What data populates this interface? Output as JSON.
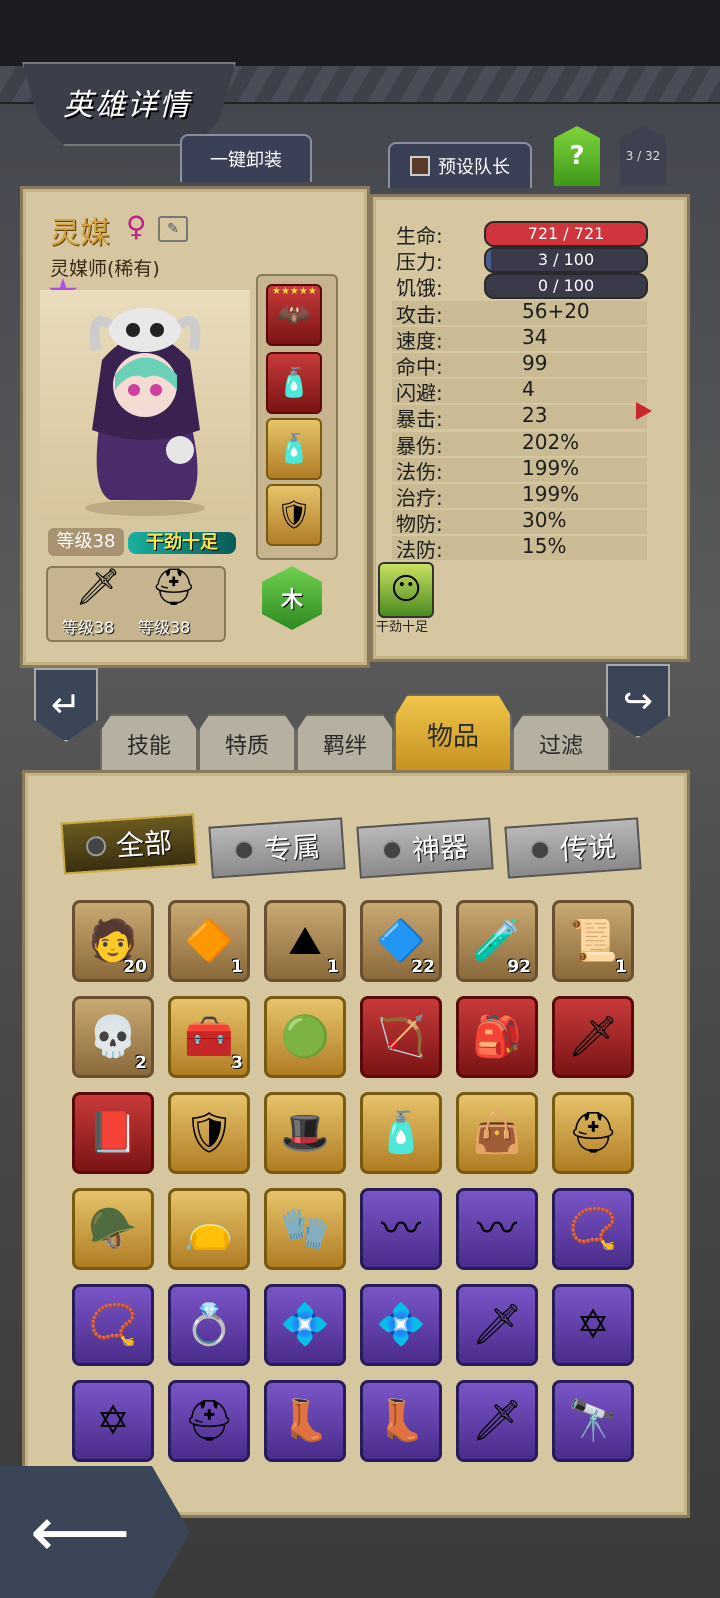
{
  "header": {
    "title": "英雄详情"
  },
  "top_buttons": {
    "unequip_all": "一键卸装",
    "preset_captain": "预设队长",
    "help": "?",
    "hero_count": "3 / 32"
  },
  "hero": {
    "name": "灵媒",
    "gender_symbol": "♀",
    "class": "灵媒师(稀有)",
    "level": "等级38",
    "mood": "干劲十足",
    "element": "木",
    "weapon_level": "等级38",
    "armor_level": "等级38",
    "slot_stars": "★★★★★"
  },
  "stats": {
    "rows": [
      {
        "label": "生命:",
        "value": "721 / 721"
      },
      {
        "label": "压力:",
        "value": "3 / 100"
      },
      {
        "label": "饥饿:",
        "value": "0 / 100"
      },
      {
        "label": "攻击:",
        "value": "56+20"
      },
      {
        "label": "速度:",
        "value": "34"
      },
      {
        "label": "命中:",
        "value": "99"
      },
      {
        "label": "闪避:",
        "value": "4"
      },
      {
        "label": "暴击:",
        "value": "23"
      },
      {
        "label": "暴伤:",
        "value": "202%"
      },
      {
        "label": "法伤:",
        "value": "199%"
      },
      {
        "label": "治疗:",
        "value": "199%"
      },
      {
        "label": "物防:",
        "value": "30%"
      },
      {
        "label": "法防:",
        "value": "15%"
      }
    ],
    "hp_fraction": 1.0,
    "stress_fraction": 0.03,
    "hunger_fraction": 0.0,
    "trait_label": "干劲十足"
  },
  "tabs": [
    "技能",
    "特质",
    "羁绊",
    "物品",
    "过滤"
  ],
  "active_tab": "物品",
  "filters": [
    "全部",
    "专属",
    "神器",
    "传说"
  ],
  "items": [
    {
      "icon": "🧑",
      "count": "20",
      "rarity": "brown"
    },
    {
      "icon": "🔶",
      "count": "1",
      "rarity": "brown"
    },
    {
      "icon": "⛰",
      "count": "1",
      "rarity": "brown"
    },
    {
      "icon": "🔷",
      "count": "22",
      "rarity": "brown"
    },
    {
      "icon": "🧪",
      "count": "92",
      "rarity": "brown"
    },
    {
      "icon": "📜",
      "count": "1",
      "rarity": "brown"
    },
    {
      "icon": "💀",
      "count": "2",
      "rarity": "brown"
    },
    {
      "icon": "🧰",
      "count": "3",
      "rarity": "gold"
    },
    {
      "icon": "🟢",
      "count": "",
      "rarity": "gold"
    },
    {
      "icon": "🏹",
      "count": "",
      "rarity": "red"
    },
    {
      "icon": "🎒",
      "count": "",
      "rarity": "red"
    },
    {
      "icon": "🗡",
      "count": "",
      "rarity": "red"
    },
    {
      "icon": "📕",
      "count": "",
      "rarity": "red"
    },
    {
      "icon": "🛡",
      "count": "",
      "rarity": "gold"
    },
    {
      "icon": "🎩",
      "count": "",
      "rarity": "gold"
    },
    {
      "icon": "🧴",
      "count": "",
      "rarity": "gold"
    },
    {
      "icon": "👜",
      "count": "",
      "rarity": "gold"
    },
    {
      "icon": "⛑",
      "count": "",
      "rarity": "gold"
    },
    {
      "icon": "🪖",
      "count": "",
      "rarity": "gold"
    },
    {
      "icon": "👝",
      "count": "",
      "rarity": "gold"
    },
    {
      "icon": "🧤",
      "count": "",
      "rarity": "gold"
    },
    {
      "icon": "〰",
      "count": "",
      "rarity": "purple"
    },
    {
      "icon": "〰",
      "count": "",
      "rarity": "purple"
    },
    {
      "icon": "📿",
      "count": "",
      "rarity": "purple"
    },
    {
      "icon": "📿",
      "count": "",
      "rarity": "purple"
    },
    {
      "icon": "💍",
      "count": "",
      "rarity": "purple"
    },
    {
      "icon": "💠",
      "count": "",
      "rarity": "purple"
    },
    {
      "icon": "💠",
      "count": "",
      "rarity": "purple"
    },
    {
      "icon": "🗡",
      "count": "",
      "rarity": "purple"
    },
    {
      "icon": "✡",
      "count": "",
      "rarity": "purple"
    },
    {
      "icon": "✡",
      "count": "",
      "rarity": "purple"
    },
    {
      "icon": "⛑",
      "count": "",
      "rarity": "purple"
    },
    {
      "icon": "👢",
      "count": "",
      "rarity": "purple"
    },
    {
      "icon": "👢",
      "count": "",
      "rarity": "purple"
    },
    {
      "icon": "🗡",
      "count": "",
      "rarity": "purple"
    },
    {
      "icon": "🔭",
      "count": "",
      "rarity": "purple"
    }
  ],
  "colors": {
    "hp_bar": "#d0343c",
    "stress_bar": "#3a3a4a",
    "active_tab": "#e6b83a",
    "accent_green": "#5ec03a"
  }
}
